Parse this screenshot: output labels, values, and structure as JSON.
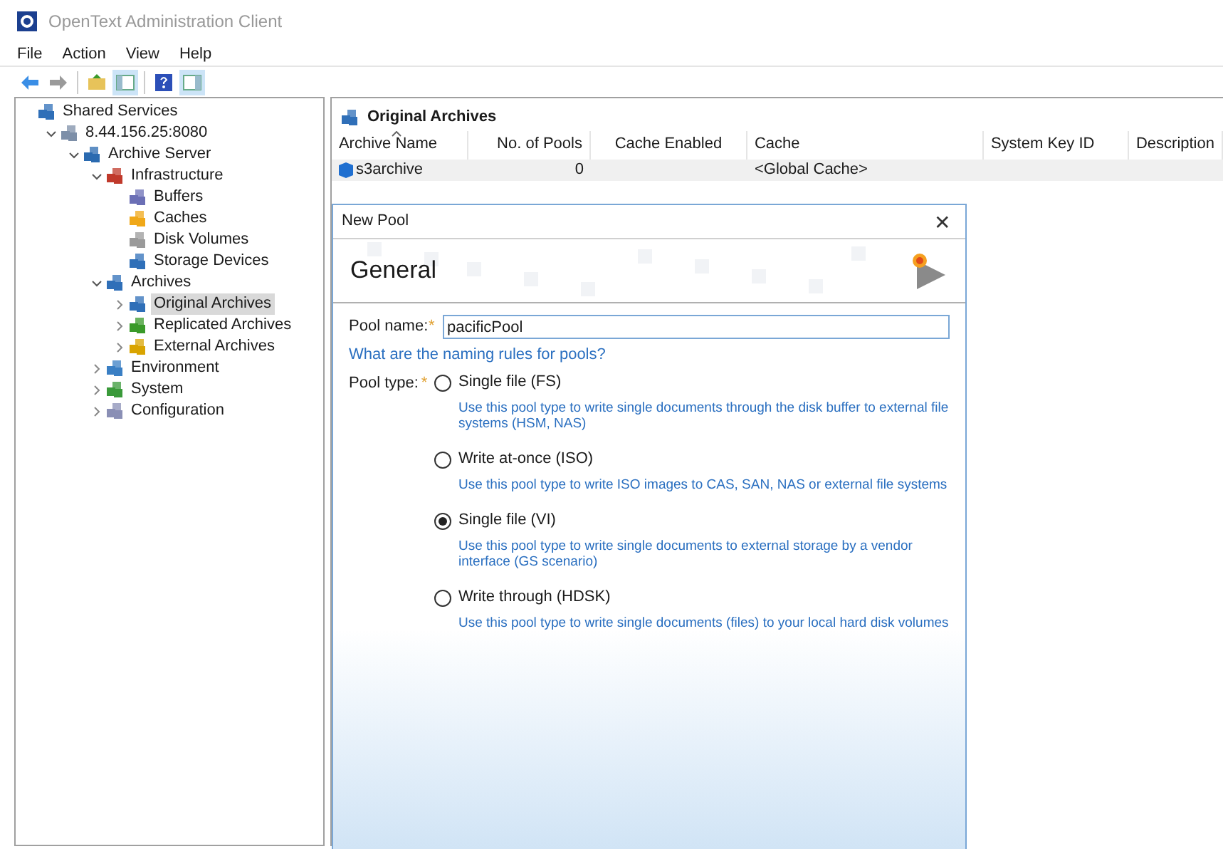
{
  "window": {
    "title": "OpenText Administration Client"
  },
  "menu": [
    "File",
    "Action",
    "View",
    "Help"
  ],
  "tree": [
    {
      "label": "Shared Services",
      "selected": false,
      "children": [
        {
          "label": "8.44.156.25:8080",
          "selected": false,
          "expanded": true,
          "children": [
            {
              "label": "Archive Server",
              "selected": false,
              "expanded": true,
              "children": [
                {
                  "label": "Infrastructure",
                  "selected": false,
                  "expanded": true,
                  "children": [
                    {
                      "label": "Buffers",
                      "selected": false
                    },
                    {
                      "label": "Caches",
                      "selected": false
                    },
                    {
                      "label": "Disk Volumes",
                      "selected": false
                    },
                    {
                      "label": "Storage Devices",
                      "selected": false
                    }
                  ]
                },
                {
                  "label": "Archives",
                  "selected": false,
                  "expanded": true,
                  "children": [
                    {
                      "label": "Original Archives",
                      "selected": true,
                      "expanded": false
                    },
                    {
                      "label": "Replicated Archives",
                      "selected": false,
                      "expanded": false
                    },
                    {
                      "label": "External Archives",
                      "selected": false,
                      "expanded": false
                    }
                  ]
                },
                {
                  "label": "Environment",
                  "selected": false,
                  "expanded": false
                },
                {
                  "label": "System",
                  "selected": false,
                  "expanded": false
                },
                {
                  "label": "Configuration",
                  "selected": false,
                  "expanded": false
                }
              ]
            }
          ]
        }
      ]
    }
  ],
  "content": {
    "title": "Original Archives",
    "columns": [
      {
        "label": "Archive Name",
        "sorted": true
      },
      {
        "label": "No. of Pools",
        "sorted": false
      },
      {
        "label": "Cache Enabled",
        "sorted": false
      },
      {
        "label": "Cache",
        "sorted": false
      },
      {
        "label": "System Key ID",
        "sorted": false
      },
      {
        "label": "Description",
        "sorted": false
      }
    ],
    "rows": [
      {
        "cells": [
          "s3archive",
          "0",
          "",
          "<Global Cache>",
          "",
          ""
        ],
        "selected": true
      }
    ]
  },
  "dialog": {
    "title": "New Pool",
    "close": "✕",
    "heading": "General",
    "pool_name": {
      "label": "Pool name:",
      "required": "*",
      "value": "pacificPool"
    },
    "help_link": "What are the naming rules for pools?",
    "pool_type": {
      "label": "Pool type:",
      "required": "*",
      "options": [
        {
          "label": "Single file (FS)",
          "selected": false,
          "description": "Use this pool type to write single documents through the disk buffer to external file systems (HSM, NAS)"
        },
        {
          "label": "Write at-once (ISO)",
          "selected": false,
          "description": "Use this pool type to write ISO images to CAS, SAN, NAS or external file systems"
        },
        {
          "label": "Single file (VI)",
          "selected": true,
          "description": "Use this pool type to write single documents to external storage by a vendor interface (GS scenario)"
        },
        {
          "label": "Write through (HDSK)",
          "selected": false,
          "description": "Use this pool type to write single documents (files) to your local hard disk volumes"
        }
      ]
    }
  }
}
